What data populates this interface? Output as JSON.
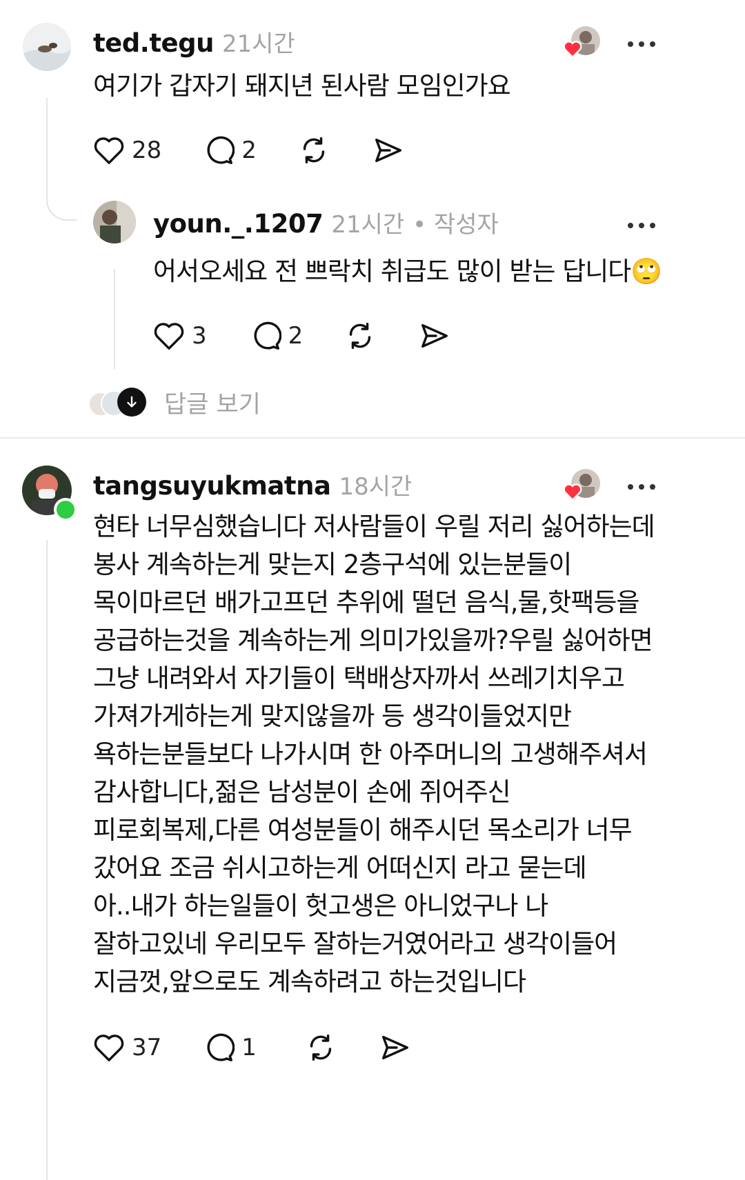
{
  "posts": [
    {
      "username": "ted.tegu",
      "time": "21시간",
      "text_lines": [
        "여기가  갑자기 돼지년 된사람 모임인가요"
      ],
      "likes": "28",
      "replies": "2"
    },
    {
      "username": "youn._.1207",
      "time": "21시간",
      "author_badge": "• 작성자",
      "text_lines": [
        "어서오세요 전 쁘락치 취급도 많이 받는 답니다🙄"
      ],
      "likes": "3",
      "replies": "2"
    }
  ],
  "view_replies_label": "답글 보기",
  "post3": {
    "username": "tangsuyukmatna",
    "time": "18시간",
    "text_lines": [
      "현타 너무심했습니다 저사람들이 우릴 저리 싫어하는데",
      "봉사 계속하는게 맞는지 2층구석에 있는분들이",
      "목이마르던 배가고프던 추위에 떨던 음식,물,핫팩등을",
      "공급하는것을 계속하는게 의미가있을까?우릴 싫어하면",
      "그냥 내려와서 자기들이 택배상자까서 쓰레기치우고",
      "가져가게하는게 맞지않을까 등 생각이들었지만",
      "욕하는분들보다 나가시며 한 아주머니의 고생해주셔서",
      "감사합니다,젊은 남성분이 손에 쥐어주신",
      "피로회복제,다른 여성분들이 해주시던 목소리가 너무",
      "갔어요 조금 쉬시고하는게 어떠신지 라고 묻는데",
      "아..내가 하는일들이 헛고생은 아니었구나 나",
      "잘하고있네 우리모두 잘하는거였어라고 생각이들어",
      "지금껏,앞으로도 계속하려고 하는것입니다"
    ],
    "likes": "37",
    "replies": "1"
  },
  "colors": {
    "like_heart": "#ff3040",
    "online_dot": "#2ecc40",
    "meta_gray": "#a4a4a4"
  }
}
